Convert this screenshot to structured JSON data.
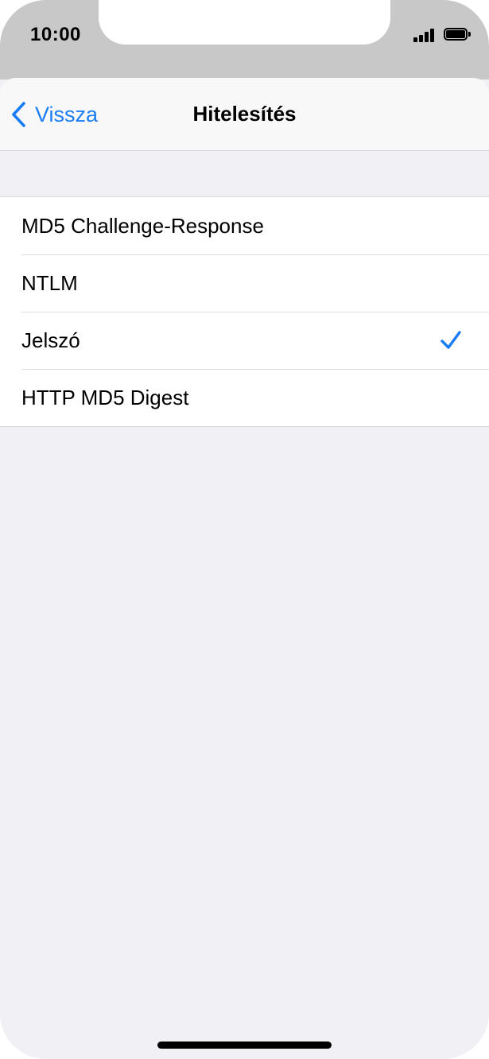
{
  "status_bar": {
    "time": "10:00",
    "signal_icon": "cellular-signal-icon",
    "battery_icon": "battery-icon"
  },
  "navbar": {
    "back_label": "Vissza",
    "back_icon": "chevron-left-icon",
    "title": "Hitelesítés"
  },
  "options": [
    {
      "label": "MD5 Challenge-Response",
      "selected": false
    },
    {
      "label": "NTLM",
      "selected": false
    },
    {
      "label": "Jelszó",
      "selected": true
    },
    {
      "label": "HTTP MD5 Digest",
      "selected": false
    }
  ],
  "colors": {
    "accent": "#1a7df5",
    "background": "#f0f0f5",
    "status_bar_bg": "#c8c8c8"
  }
}
